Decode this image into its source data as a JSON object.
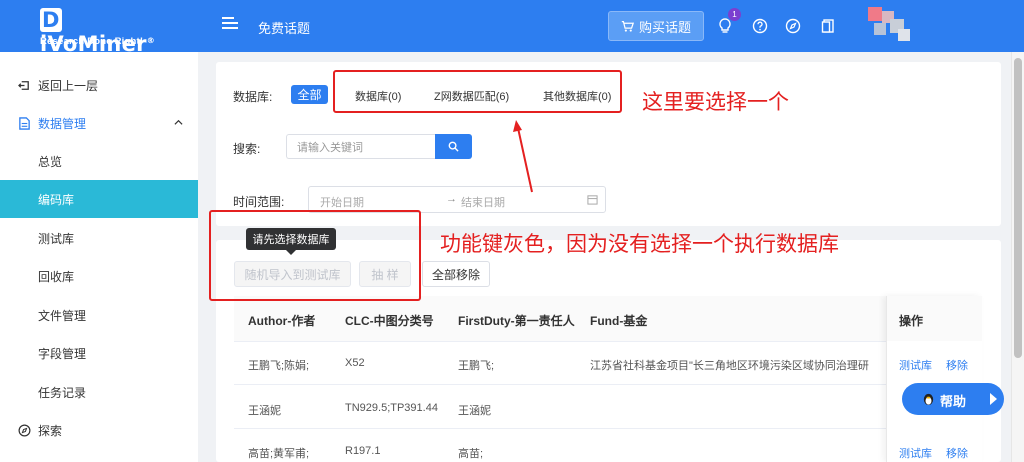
{
  "header": {
    "logo_main": "iVoMiner",
    "logo_d": "D",
    "logo_registered": "®",
    "logo_sub": "Research Done Right!",
    "page_title": "免费话题",
    "buy_button": "购买话题",
    "notification_count": "1"
  },
  "sidebar": {
    "items": [
      {
        "label": "返回上一层"
      },
      {
        "label": "数据管理"
      },
      {
        "label": "总览"
      },
      {
        "label": "编码库"
      },
      {
        "label": "测试库"
      },
      {
        "label": "回收库"
      },
      {
        "label": "文件管理"
      },
      {
        "label": "字段管理"
      },
      {
        "label": "任务记录"
      },
      {
        "label": "探索"
      }
    ]
  },
  "filters": {
    "db_label": "数据库:",
    "db_all": "全部",
    "db_tabs": [
      "数据库(0)",
      "Z网数据匹配(6)",
      "其他数据库(0)"
    ],
    "search_label": "搜索:",
    "search_placeholder": "请输入关键词",
    "time_label": "时间范围:",
    "start_date": "开始日期",
    "end_date": "结束日期",
    "arrow": "→"
  },
  "actions": {
    "tooltip": "请先选择数据库",
    "random_import": "随机导入到测试库",
    "sample": "抽 样",
    "remove_all": "全部移除"
  },
  "table": {
    "headers": [
      "Author-作者",
      "CLC-中图分类号",
      "FirstDuty-第一责任人",
      "Fund-基金",
      "操作"
    ],
    "rows": [
      {
        "author": "王鹏飞;陈娟;",
        "clc": "X52",
        "first_duty": "王鹏飞;",
        "fund": "江苏省社科基金项目\"长三角地区环境污染区域协同治理研"
      },
      {
        "author": "王涵妮",
        "clc": "TN929.5;TP391.44",
        "first_duty": "王涵妮",
        "fund": ""
      },
      {
        "author": "高苗;黄军甫;",
        "clc": "R197.1",
        "first_duty": "高苗;",
        "fund": ""
      }
    ],
    "op_test": "测试库",
    "op_remove": "移除"
  },
  "help": {
    "label": "帮助"
  },
  "annotations": {
    "top": "这里要选择一个",
    "bottom": "功能键灰色，因为没有选择一个执行数据库"
  },
  "colors": {
    "primary": "#2d7ef0",
    "active_sidebar": "#2ab9d7",
    "annotation": "#e42020"
  }
}
